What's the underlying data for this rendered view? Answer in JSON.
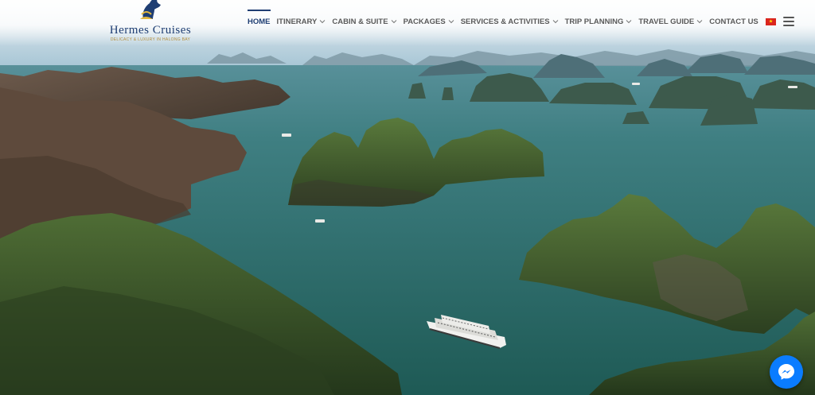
{
  "brand": {
    "name": "Hermes Cruises",
    "tagline": "DELICACY & LUXURY IN HALONG BAY",
    "mark_icon": "horse-head-logo"
  },
  "nav": {
    "items": [
      {
        "label": "HOME",
        "active": true,
        "has_dropdown": false
      },
      {
        "label": "ITINERARY",
        "active": false,
        "has_dropdown": true
      },
      {
        "label": "CABIN & SUITE",
        "active": false,
        "has_dropdown": true
      },
      {
        "label": "PACKAGES",
        "active": false,
        "has_dropdown": true
      },
      {
        "label": "SERVICES & ACTIVITIES",
        "active": false,
        "has_dropdown": true
      },
      {
        "label": "TRIP PLANNING",
        "active": false,
        "has_dropdown": true
      },
      {
        "label": "TRAVEL GUIDE",
        "active": false,
        "has_dropdown": true
      },
      {
        "label": "CONTACT US",
        "active": false,
        "has_dropdown": false
      }
    ],
    "language_icon": "vietnam-flag-icon",
    "menu_icon": "hamburger-menu-icon"
  },
  "hero": {
    "image": "aerial-halong-bay-photo",
    "description_icon": "cruise-ship"
  },
  "chat": {
    "icon": "messenger-icon"
  },
  "colors": {
    "brand_navy": "#1f3e73",
    "brand_gold": "#b48d3b",
    "nav_text": "#5a5a5a",
    "messenger_blue": "#0a7cff",
    "water": "#2f6f6c"
  }
}
